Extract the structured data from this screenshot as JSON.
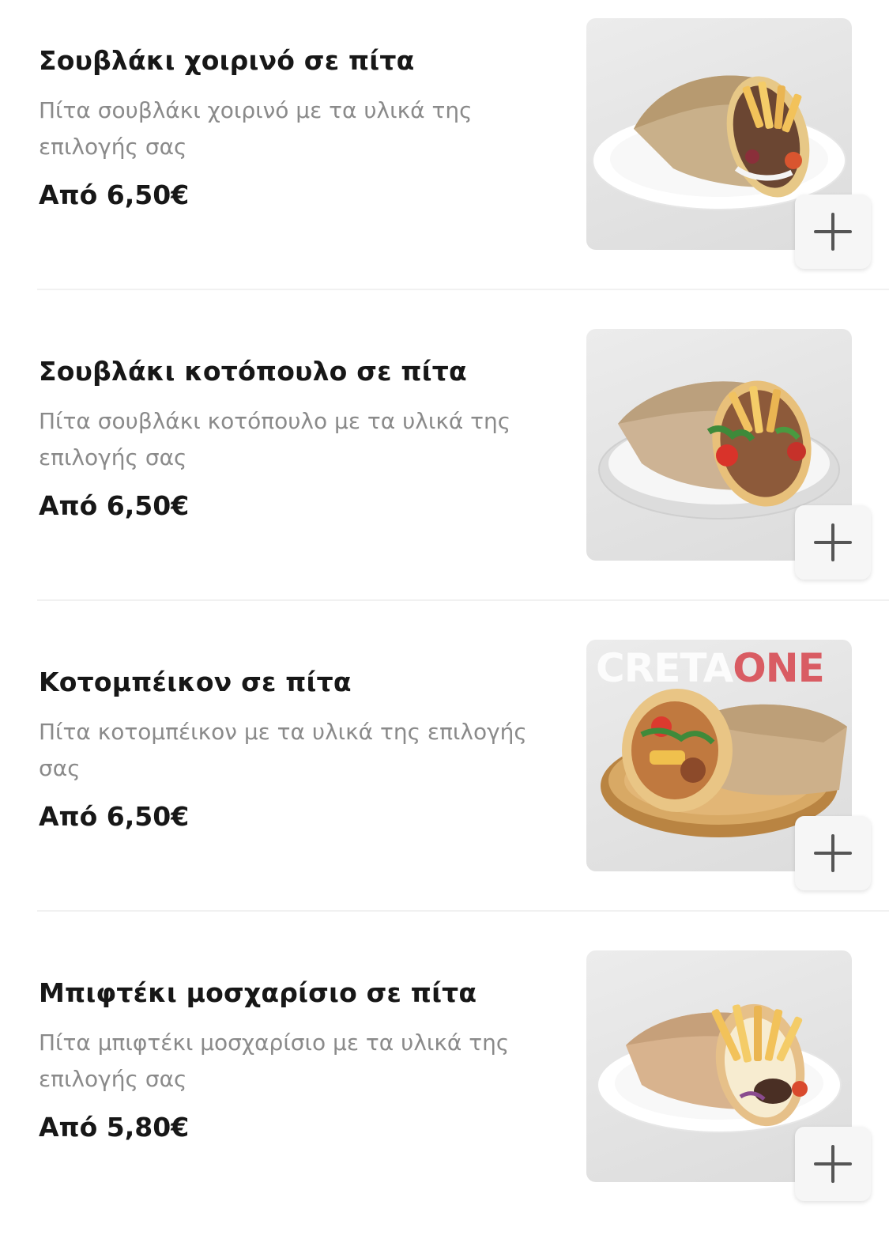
{
  "menu": {
    "items": [
      {
        "title": "Σουβλάκι χοιρινό σε πίτα",
        "description": "Πίτα σουβλάκι χοιρινό με τα υλικά της επιλογής σας",
        "price": "Από 6,50€",
        "image_icon": "pork-souvlaki-pita-photo",
        "add_icon": "plus-icon"
      },
      {
        "title": "Σουβλάκι κοτόπουλο σε πίτα",
        "description": "Πίτα σουβλάκι κοτόπουλο με τα υλικά της επιλογής σας",
        "price": "Από 6,50€",
        "image_icon": "chicken-souvlaki-pita-photo",
        "add_icon": "plus-icon"
      },
      {
        "title": "Κοτομπέικον σε πίτα",
        "description": "Πίτα κοτομπέικον με τα υλικά της επιλογής σας",
        "price": "Από 6,50€",
        "image_icon": "chicken-bacon-pita-photo",
        "image_watermark": {
          "part1": "CRETA",
          "part2": "ONE"
        },
        "add_icon": "plus-icon"
      },
      {
        "title": "Μπιφτέκι μοσχαρίσιο σε πίτα",
        "description": "Πίτα μπιφτέκι μοσχαρίσιο με τα υλικά της επιλογής σας",
        "price": "Από 5,80€",
        "image_icon": "beef-burger-pita-photo",
        "add_icon": "plus-icon"
      }
    ]
  },
  "colors": {
    "title": "#171717",
    "description": "#8a8a8a",
    "watermark_accent": "#d95c63",
    "divider": "#f1f1f1"
  }
}
